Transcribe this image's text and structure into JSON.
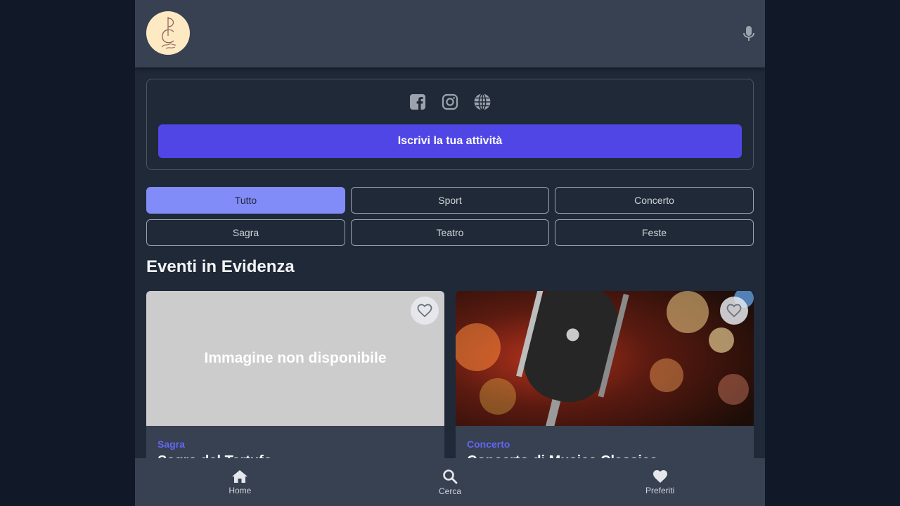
{
  "header": {
    "logo_icon": "pc-monogram-logo",
    "voice_icon": "microphone-icon"
  },
  "promo": {
    "socials": [
      {
        "icon": "facebook-icon"
      },
      {
        "icon": "instagram-icon"
      },
      {
        "icon": "globe-icon"
      }
    ],
    "cta_label": "Iscrivi la tua attività",
    "cta_color": "#4f46e5"
  },
  "filters": {
    "active": "Tutto",
    "active_color": "#818cf8",
    "items": [
      "Tutto",
      "Sport",
      "Concerto",
      "Sagra",
      "Teatro",
      "Feste"
    ]
  },
  "featured": {
    "title": "Eventi in Evidenza",
    "cards": [
      {
        "image_placeholder": "Immagine non disponibile",
        "category": "Sagra",
        "title": "Sagra del Tartufo"
      },
      {
        "image": "vintage-microphone-photo",
        "category": "Concerto",
        "title": "Concerto di Musica Classica"
      }
    ]
  },
  "bottom_nav": {
    "items": [
      {
        "label": "Home",
        "icon": "home-icon"
      },
      {
        "label": "Cerca",
        "icon": "search-icon"
      },
      {
        "label": "Preferiti",
        "icon": "heart-icon"
      }
    ]
  }
}
